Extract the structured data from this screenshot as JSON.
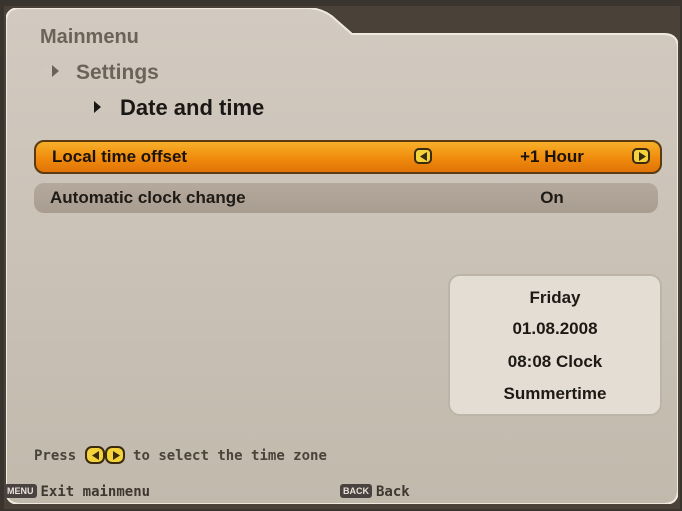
{
  "breadcrumb": {
    "level1": "Mainmenu",
    "level2": "Settings",
    "level3": "Date and time"
  },
  "rows": [
    {
      "label": "Local time offset",
      "value": "+1 Hour",
      "selected": true
    },
    {
      "label": "Automatic clock change",
      "value": "On",
      "selected": false
    }
  ],
  "info": {
    "day": "Friday",
    "date": "01.08.2008",
    "time": "08:08 Clock",
    "mode": "Summertime"
  },
  "hint": {
    "press": "Press",
    "text": "to select the time zone"
  },
  "footer": {
    "menu_key": "MENU",
    "menu_label": "Exit mainmenu",
    "back_key": "BACK",
    "back_label": "Back"
  },
  "colors": {
    "panel": "#c7bfb4",
    "highlight": "#f08a0c",
    "row": "#aca194",
    "infobox": "#e3ddd3",
    "button": "#f3d23a"
  },
  "icons": [
    "arrow-right-icon",
    "arrow-left-icon"
  ]
}
